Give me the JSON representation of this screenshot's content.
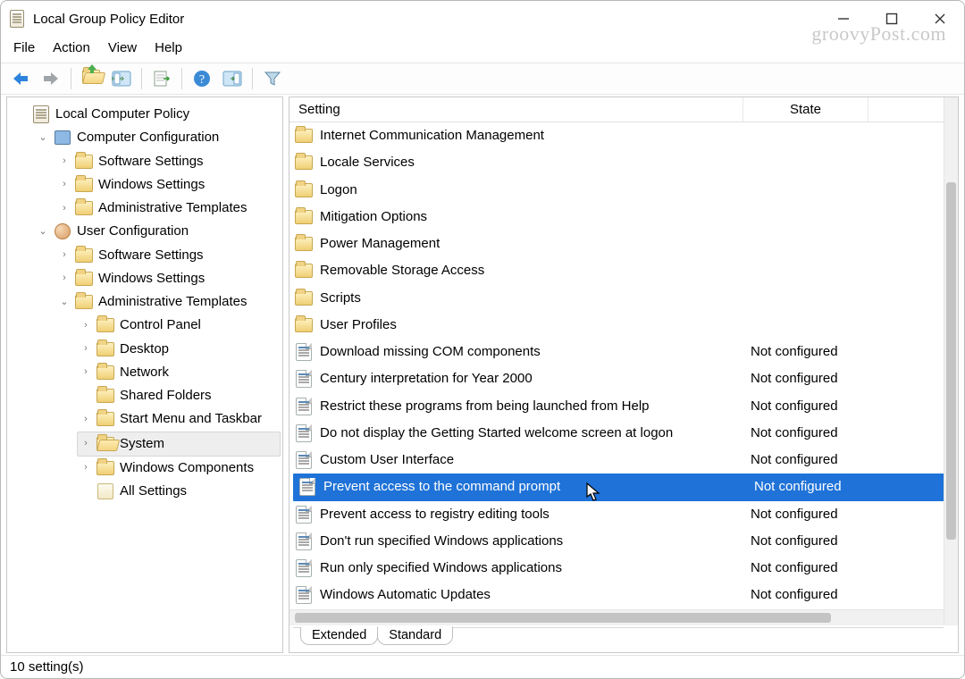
{
  "title": "Local Group Policy Editor",
  "watermark": "groovyPost.com",
  "menu": {
    "file": "File",
    "action": "Action",
    "view": "View",
    "help": "Help"
  },
  "toolbar": {
    "back": "back",
    "forward": "forward",
    "up": "up-folder",
    "props": "show-hide-console-tree",
    "export": "export-list",
    "help": "help",
    "action_bar": "show-hide-action-pane",
    "filter": "filter"
  },
  "columns": {
    "setting": "Setting",
    "state": "State"
  },
  "tabs": {
    "extended": "Extended",
    "standard": "Standard"
  },
  "status": "10 setting(s)",
  "tree": {
    "root": "Local Computer Policy",
    "cc": "Computer Configuration",
    "cc_children": [
      "Software Settings",
      "Windows Settings",
      "Administrative Templates"
    ],
    "uc": "User Configuration",
    "uc_children": [
      "Software Settings",
      "Windows Settings"
    ],
    "uc_at": "Administrative Templates",
    "at_children": [
      "Control Panel",
      "Desktop",
      "Network",
      "Shared Folders",
      "Start Menu and Taskbar",
      "System",
      "Windows Components",
      "All Settings"
    ],
    "selected": "System"
  },
  "folders": [
    "Internet Communication Management",
    "Locale Services",
    "Logon",
    "Mitigation Options",
    "Power Management",
    "Removable Storage Access",
    "Scripts",
    "User Profiles"
  ],
  "settings": [
    {
      "name": "Download missing COM components",
      "state": "Not configured"
    },
    {
      "name": "Century interpretation for Year 2000",
      "state": "Not configured"
    },
    {
      "name": "Restrict these programs from being launched from Help",
      "state": "Not configured"
    },
    {
      "name": "Do not display the Getting Started welcome screen at logon",
      "state": "Not configured"
    },
    {
      "name": "Custom User Interface",
      "state": "Not configured"
    },
    {
      "name": "Prevent access to the command prompt",
      "state": "Not configured",
      "selected": true
    },
    {
      "name": "Prevent access to registry editing tools",
      "state": "Not configured"
    },
    {
      "name": "Don't run specified Windows applications",
      "state": "Not configured"
    },
    {
      "name": "Run only specified Windows applications",
      "state": "Not configured"
    },
    {
      "name": "Windows Automatic Updates",
      "state": "Not configured"
    }
  ],
  "cursor_row": 5
}
